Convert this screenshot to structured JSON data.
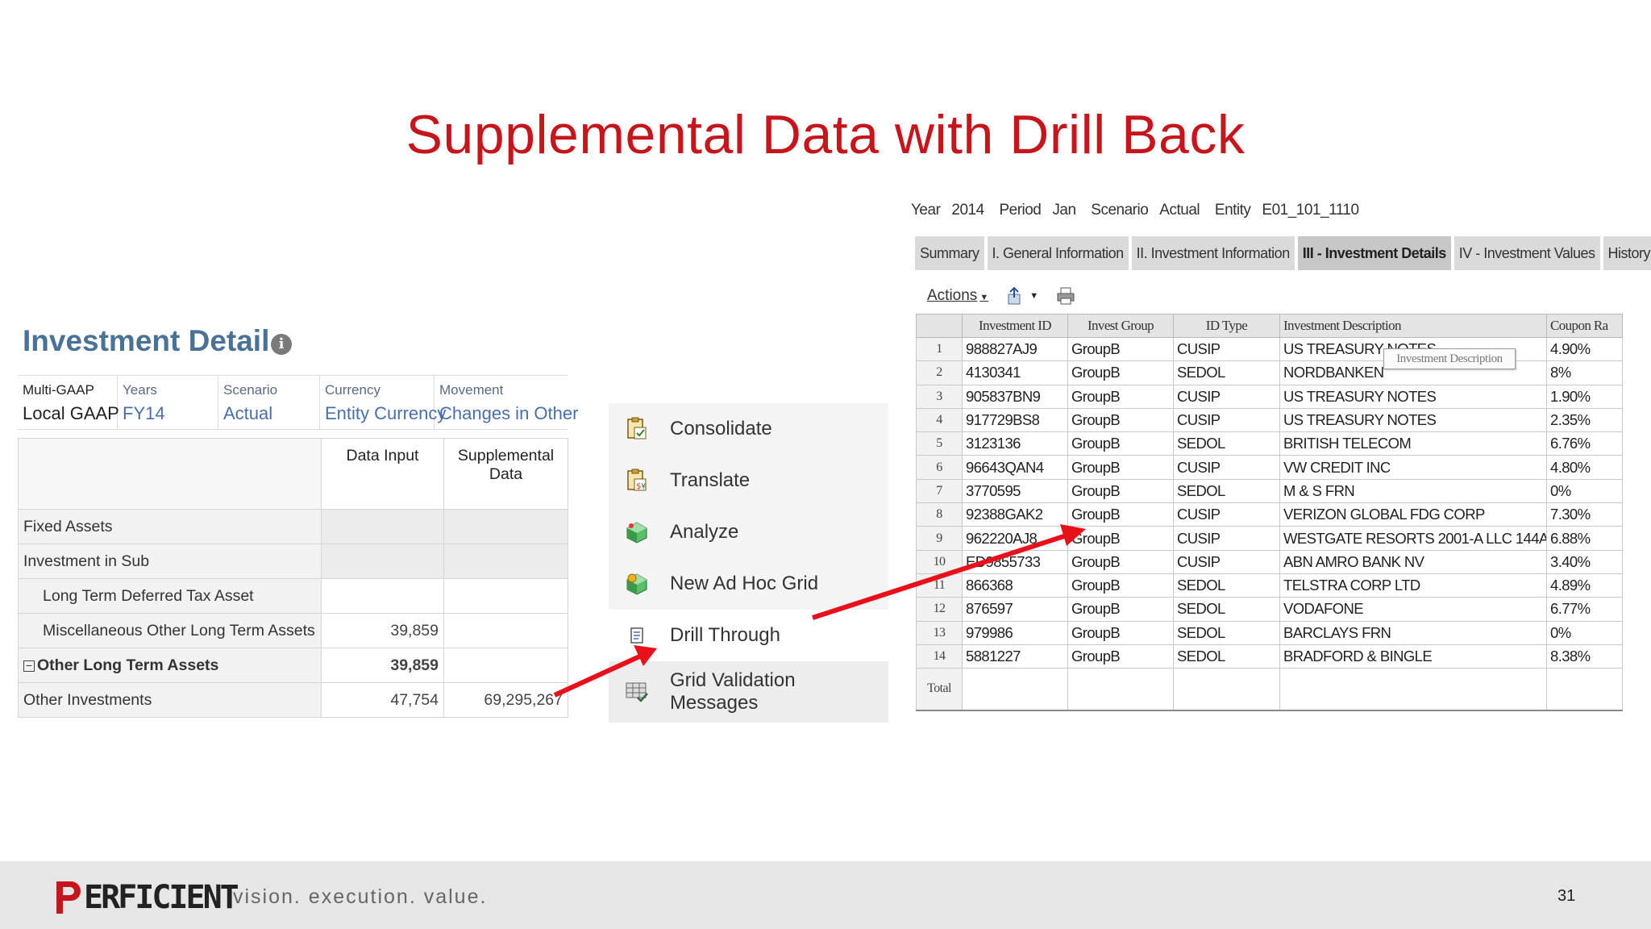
{
  "slide": {
    "title": "Supplemental Data with Drill Back",
    "page_number": "31"
  },
  "left_panel": {
    "title": "Investment Detail",
    "info_icon": "info-icon",
    "pov": [
      {
        "label": "Multi-GAAP",
        "value": "Local GAAP"
      },
      {
        "label": "Years",
        "value": "FY14"
      },
      {
        "label": "Scenario",
        "value": "Actual"
      },
      {
        "label": "Currency",
        "value": "Entity Currency"
      },
      {
        "label": "Movement",
        "value": "Changes in Other"
      }
    ],
    "columns": [
      "Data Input",
      "Supplemental Data"
    ],
    "rows": [
      {
        "label": "Fixed Assets",
        "data_input": "",
        "supplemental": ""
      },
      {
        "label": "Investment in Sub",
        "data_input": "",
        "supplemental": ""
      },
      {
        "label": "Long Term Deferred Tax Asset",
        "data_input": "",
        "supplemental": ""
      },
      {
        "label": "Miscellaneous Other Long Term Assets",
        "data_input": "39,859",
        "supplemental": ""
      },
      {
        "label": "Other Long Term Assets",
        "data_input": "39,859",
        "supplemental": ""
      },
      {
        "label": "Other Investments",
        "data_input": "47,754",
        "supplemental": "69,295,267"
      }
    ]
  },
  "context_menu": {
    "items": [
      {
        "label": "Consolidate",
        "icon": "consolidate-icon"
      },
      {
        "label": "Translate",
        "icon": "translate-icon"
      },
      {
        "label": "Analyze",
        "icon": "analyze-icon"
      },
      {
        "label": "New Ad Hoc Grid",
        "icon": "new-ad-hoc-grid-icon"
      },
      {
        "label": "Drill Through",
        "icon": "drill-through-icon"
      },
      {
        "label": "Grid Validation Messages",
        "icon": "grid-validation-icon"
      }
    ]
  },
  "right_panel": {
    "context": {
      "year_label": "Year",
      "year": "2014",
      "period_label": "Period",
      "period": "Jan",
      "scenario_label": "Scenario",
      "scenario": "Actual",
      "entity_label": "Entity",
      "entity": "E01_101_1110"
    },
    "tabs": [
      "Summary",
      "I. General Information",
      "II. Investment Information",
      "III - Investment Details",
      "IV - Investment Values",
      "History"
    ],
    "active_tab": "III - Investment Details",
    "toolbar": {
      "actions_label": "Actions"
    },
    "columns": [
      "Investment ID",
      "Invest Group",
      "ID Type",
      "Investment Description",
      "Coupon Ra"
    ],
    "tooltip": "Investment Description",
    "rows": [
      {
        "n": "1",
        "id": "988827AJ9",
        "group": "GroupB",
        "type": "CUSIP",
        "desc": "US TREASURY NOTES",
        "coupon": "4.90%"
      },
      {
        "n": "2",
        "id": "4130341",
        "group": "GroupB",
        "type": "SEDOL",
        "desc": "NORDBANKEN",
        "coupon": "8%"
      },
      {
        "n": "3",
        "id": "905837BN9",
        "group": "GroupB",
        "type": "CUSIP",
        "desc": "US TREASURY NOTES",
        "coupon": "1.90%"
      },
      {
        "n": "4",
        "id": "917729BS8",
        "group": "GroupB",
        "type": "CUSIP",
        "desc": "US TREASURY NOTES",
        "coupon": "2.35%"
      },
      {
        "n": "5",
        "id": "3123136",
        "group": "GroupB",
        "type": "SEDOL",
        "desc": "BRITISH TELECOM",
        "coupon": "6.76%"
      },
      {
        "n": "6",
        "id": "96643QAN4",
        "group": "GroupB",
        "type": "CUSIP",
        "desc": "VW CREDIT INC",
        "coupon": "4.80%"
      },
      {
        "n": "7",
        "id": "3770595",
        "group": "GroupB",
        "type": "SEDOL",
        "desc": "M & S FRN",
        "coupon": "0%"
      },
      {
        "n": "8",
        "id": "92388GAK2",
        "group": "GroupB",
        "type": "CUSIP",
        "desc": "VERIZON GLOBAL FDG CORP",
        "coupon": "7.30%"
      },
      {
        "n": "9",
        "id": "962220AJ8",
        "group": "GroupB",
        "type": "CUSIP",
        "desc": "WESTGATE RESORTS 2001-A LLC 144A",
        "coupon": "6.88%"
      },
      {
        "n": "10",
        "id": "ED9855733",
        "group": "GroupB",
        "type": "CUSIP",
        "desc": "ABN AMRO BANK NV",
        "coupon": "3.40%"
      },
      {
        "n": "11",
        "id": "866368",
        "group": "GroupB",
        "type": "SEDOL",
        "desc": "TELSTRA CORP LTD",
        "coupon": "4.89%"
      },
      {
        "n": "12",
        "id": "876597",
        "group": "GroupB",
        "type": "SEDOL",
        "desc": "VODAFONE",
        "coupon": "6.77%"
      },
      {
        "n": "13",
        "id": "979986",
        "group": "GroupB",
        "type": "SEDOL",
        "desc": "BARCLAYS FRN",
        "coupon": "0%"
      },
      {
        "n": "14",
        "id": "5881227",
        "group": "GroupB",
        "type": "SEDOL",
        "desc": "BRADFORD & BINGLE",
        "coupon": "8.38%"
      }
    ],
    "total_label": "Total"
  },
  "footer": {
    "logo_text": "ERFICIENT",
    "tagline": "vision.  execution.  value."
  },
  "colors": {
    "title_red": "#c4161c",
    "arrow_red": "#e8101a",
    "detail_blue": "#4a7196"
  }
}
